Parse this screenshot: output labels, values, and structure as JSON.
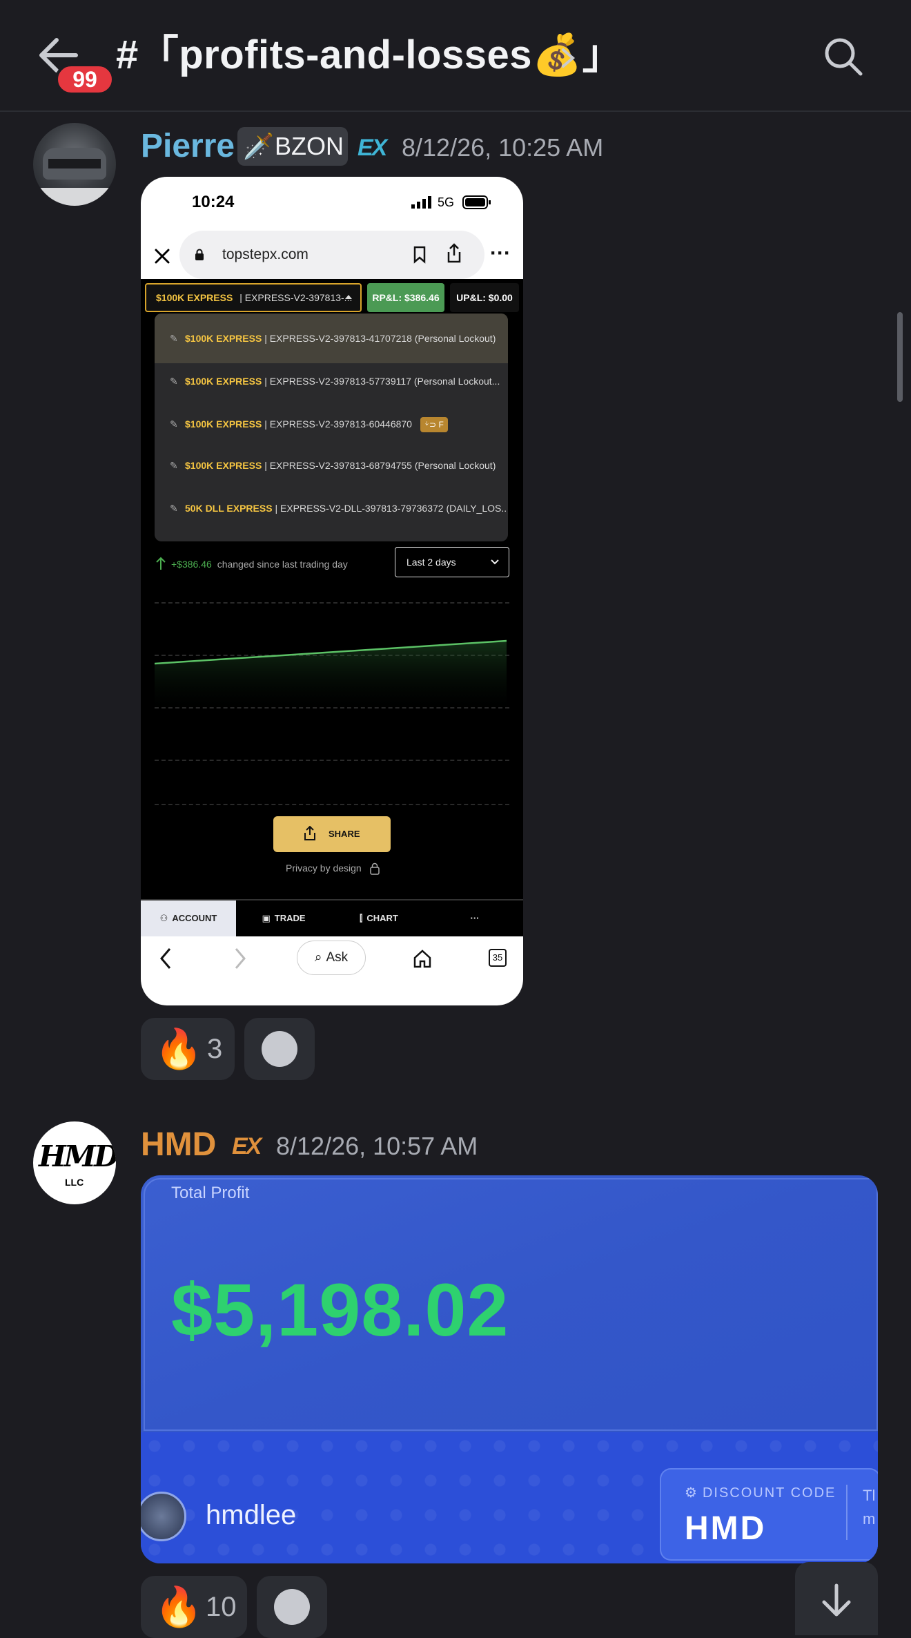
{
  "header": {
    "unread_count": "99",
    "channel_name": "#「profits-and-losses💰」"
  },
  "messages": [
    {
      "username": "Pierre",
      "tag_emoji": "🗡️",
      "tag_label": "BZON",
      "server_badge": "EX",
      "timestamp": "8/12/26, 10:25 AM",
      "reaction": {
        "emoji": "🔥",
        "count": "3"
      }
    },
    {
      "username": "HMD",
      "server_badge": "EX",
      "timestamp": "8/12/26, 10:57 AM",
      "reaction": {
        "emoji": "🔥",
        "count": "10"
      }
    }
  ],
  "screenshot": {
    "status_time": "10:24",
    "network": "5G",
    "url": "topstepx.com",
    "account_selected_bold": "$100K EXPRESS",
    "account_selected_rest": "| EXPRESS-V2-397813-...",
    "rpl": "RP&L: $386.46",
    "upl": "UP&L: $0.00",
    "dropdown": [
      {
        "bold": "$100K EXPRESS",
        "rest": "|  EXPRESS-V2-397813-41707218  (Personal Lockout)"
      },
      {
        "bold": "$100K EXPRESS",
        "rest": "|  EXPRESS-V2-397813-57739117  (Personal Lockout..."
      },
      {
        "bold": "$100K EXPRESS",
        "rest": "|  EXPRESS-V2-397813-60446870",
        "chip": "ᛎ⊃ F"
      },
      {
        "bold": "$100K EXPRESS",
        "rest": "|  EXPRESS-V2-397813-68794755  (Personal Lockout)"
      },
      {
        "bold": "50K DLL EXPRESS",
        "rest": "|  EXPRESS-V2-DLL-397813-79736372  (DAILY_LOS..."
      }
    ],
    "change_value": "+$386.46",
    "change_text": "changed since last trading day",
    "range_select": "Last 2 days",
    "share_label": "SHARE",
    "privacy_text": "Privacy by design",
    "tabs": [
      "ACCOUNT",
      "TRADE",
      "CHART",
      "···"
    ],
    "ask_label": "Ask",
    "tab_count": "35"
  },
  "profit_card": {
    "label": "Total Profit",
    "amount": "$5,198.02",
    "user": "hmdlee",
    "discount_label": "DISCOUNT CODE",
    "discount_code": "HMD",
    "cut_text_1": "Tl",
    "cut_text_2": "m"
  }
}
